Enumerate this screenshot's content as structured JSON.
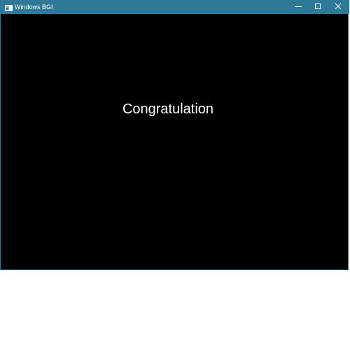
{
  "window": {
    "title": "Windows BGI",
    "icon": "console-app-icon",
    "controls": {
      "minimize_icon": "minimize-icon",
      "maximize_icon": "maximize-icon",
      "close_icon": "close-icon"
    }
  },
  "canvas": {
    "message": "Congratulation",
    "background_color": "#000000",
    "text_color": "#ffffff"
  },
  "colors": {
    "titlebar": "#2d7a98",
    "titlebar_text": "#ffffff"
  }
}
